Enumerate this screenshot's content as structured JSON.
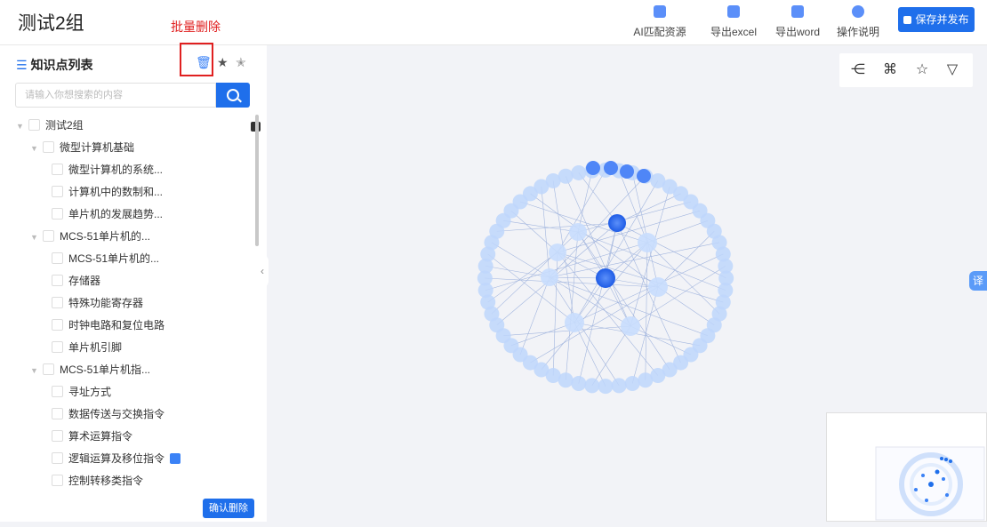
{
  "header": {
    "title": "测试2组",
    "annotation": "批量删除",
    "tools": [
      {
        "label": "AI匹配资源",
        "icon": "ai-chip-icon"
      },
      {
        "label": "导出excel",
        "icon": "export-icon"
      },
      {
        "label": "导出word",
        "icon": "word-doc-icon"
      },
      {
        "label": "操作说明",
        "icon": "info-icon"
      }
    ],
    "publish_label": "保存并发布"
  },
  "sidebar": {
    "title": "知识点列表",
    "search_placeholder": "请输入你想搜索的内容",
    "tree": [
      {
        "label": "测试2组",
        "level": 0
      },
      {
        "label": "微型计算机基础",
        "level": 1
      },
      {
        "label": "微型计算机的系统...",
        "level": 2
      },
      {
        "label": "计算机中的数制和...",
        "level": 2
      },
      {
        "label": "单片机的发展趋势...",
        "level": 2
      },
      {
        "label": "MCS-51单片机的...",
        "level": 1
      },
      {
        "label": "MCS-51单片机的...",
        "level": 2
      },
      {
        "label": "存储器",
        "level": 2
      },
      {
        "label": "特殊功能寄存器",
        "level": 2
      },
      {
        "label": "时钟电路和复位电路",
        "level": 2
      },
      {
        "label": "单片机引脚",
        "level": 2
      },
      {
        "label": "MCS-51单片机指...",
        "level": 1
      },
      {
        "label": "寻址方式",
        "level": 2
      },
      {
        "label": "数据传送与交换指令",
        "level": 2
      },
      {
        "label": "算术运算指令",
        "level": 2
      },
      {
        "label": "逻辑运算及移位指令",
        "level": 2
      },
      {
        "label": "控制转移类指令",
        "level": 2
      }
    ],
    "confirm_label": "确认删除"
  },
  "floating": {
    "translate_label": "译"
  },
  "colors": {
    "primary": "#1f6feb",
    "annotation": "#e02020"
  }
}
